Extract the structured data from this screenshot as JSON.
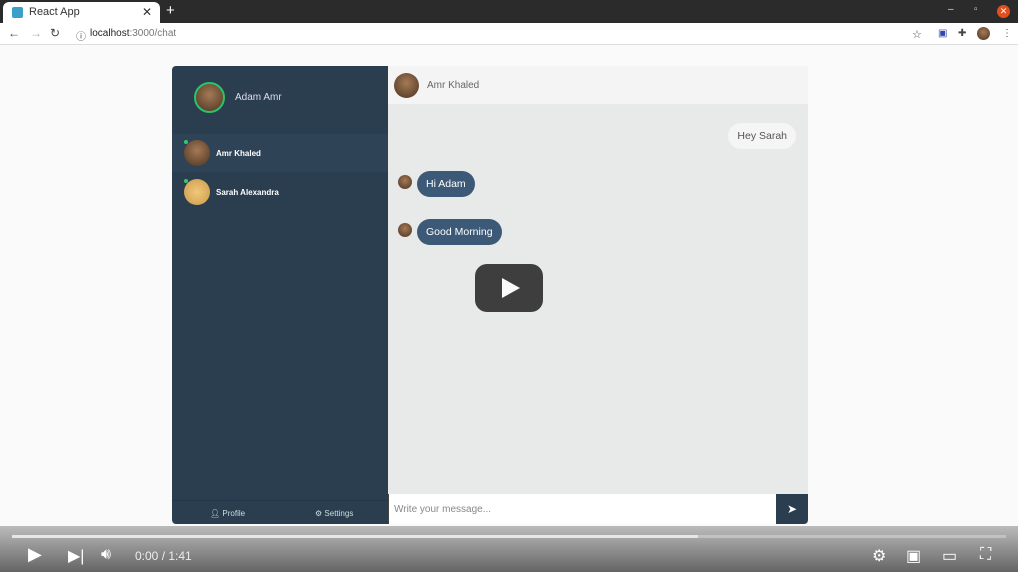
{
  "browser": {
    "tab_title": "React App",
    "url_host": "localhost",
    "url_path": ":3000/chat"
  },
  "sidebar": {
    "user_name": "Adam Amr",
    "contacts": [
      {
        "name": "Amr Khaled",
        "online": true
      },
      {
        "name": "Sarah Alexandra",
        "online": true
      }
    ],
    "footer": {
      "profile": "Profile",
      "settings": "Settings"
    }
  },
  "chat": {
    "header_name": "Amr Khaled",
    "messages": [
      {
        "text": "Hey Sarah",
        "direction": "outgoing"
      },
      {
        "text": "Hi Adam",
        "direction": "incoming"
      },
      {
        "text": "Good Morning",
        "direction": "incoming"
      }
    ],
    "input_placeholder": "Write your message..."
  },
  "player": {
    "time_current": "0:00",
    "time_separator": " / ",
    "time_total": "1:41",
    "buffered_fraction": 0.69
  },
  "colors": {
    "sidebar": "#2b3e50",
    "incoming_bubble": "#3c5a78",
    "online": "#2ecc71"
  }
}
